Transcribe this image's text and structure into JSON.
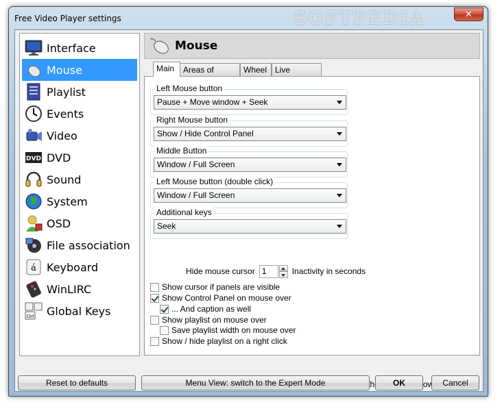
{
  "window": {
    "title": "Free Video Player settings",
    "close_label": "✕",
    "watermark": "SOFTPEDIA"
  },
  "sidebar": {
    "items": [
      {
        "label": "Interface",
        "icon": "monitor-icon",
        "selected": false
      },
      {
        "label": "Mouse",
        "icon": "mouse-icon",
        "selected": true
      },
      {
        "label": "Playlist",
        "icon": "playlist-icon",
        "selected": false
      },
      {
        "label": "Events",
        "icon": "clock-icon",
        "selected": false
      },
      {
        "label": "Video",
        "icon": "camera-icon",
        "selected": false
      },
      {
        "label": "DVD",
        "icon": "dvd-icon",
        "selected": false
      },
      {
        "label": "Sound",
        "icon": "headphones-icon",
        "selected": false
      },
      {
        "label": "System",
        "icon": "globe-icon",
        "selected": false
      },
      {
        "label": "OSD",
        "icon": "user-osd-icon",
        "selected": false
      },
      {
        "label": "File association",
        "icon": "media-icon",
        "selected": false
      },
      {
        "label": "Keyboard",
        "icon": "key-icon",
        "selected": false
      },
      {
        "label": "WinLIRC",
        "icon": "remote-icon",
        "selected": false
      },
      {
        "label": "Global Keys",
        "icon": "global-keys-icon",
        "selected": false
      }
    ]
  },
  "panel": {
    "title": "Mouse",
    "icon": "mouse-icon"
  },
  "tabs": [
    {
      "label": "Main",
      "active": true
    },
    {
      "label": "Areas of Video",
      "active": false
    },
    {
      "label": "Wheel",
      "active": false
    },
    {
      "label": "Live Preview",
      "active": false
    }
  ],
  "groups": [
    {
      "label": "Left Mouse button",
      "value": "Pause + Move window + Seek"
    },
    {
      "label": "Right Mouse button",
      "value": "Show / Hide Control Panel"
    },
    {
      "label": "Middle Button",
      "value": "Window / Full Screen"
    },
    {
      "label": "Left Mouse button (double click)",
      "value": "Window / Full Screen"
    },
    {
      "label": "Additional keys",
      "value": "Seek"
    }
  ],
  "hide_cursor": {
    "label": "Hide mouse cursor",
    "value": "1",
    "suffix": "Inactivity in seconds"
  },
  "checkboxes": [
    {
      "label": "Show cursor if panels are visible",
      "checked": false
    },
    {
      "label": "Show Control Panel on mouse over",
      "checked": true
    },
    {
      "label": "... And caption as well",
      "checked": true
    },
    {
      "label": "Show playlist on mouse over",
      "checked": false
    },
    {
      "label": "Save playlist width on mouse over",
      "checked": false
    },
    {
      "label": "Show / hide playlist on a right click",
      "checked": false
    },
    {
      "label": "Pause with one mouse click (instead of a double click) if the player window is inactive",
      "checked": true
    }
  ],
  "buttons": {
    "reset": "Reset to defaults",
    "menu_view": "Menu View: switch to the Expert Mode",
    "ok": "OK",
    "cancel": "Cancel"
  },
  "colors": {
    "selection": "#3399ff",
    "titlebar": "#a9c4dc",
    "close": "#c7402a"
  }
}
